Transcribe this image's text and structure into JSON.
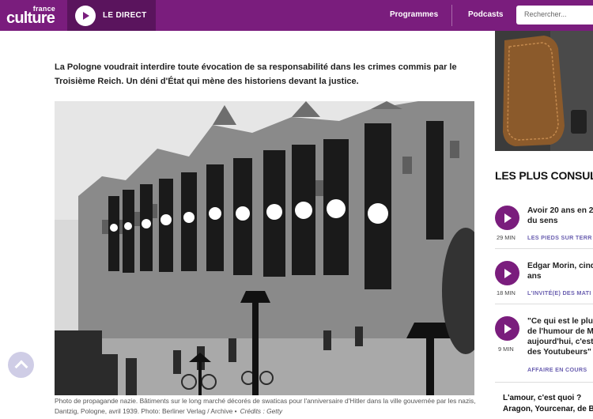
{
  "header": {
    "logo_top": "france",
    "logo_main": "culture",
    "live_label": "LE DIRECT",
    "nav": [
      "Programmes",
      "Podcasts"
    ],
    "search_placeholder": "Rechercher..."
  },
  "article": {
    "lead": "La Pologne voudrait interdire toute évocation de sa responsabilité dans les crimes commis par le Troisième Reich. Un déni d'État qui mène des historiens devant la justice.",
    "caption": "Photo de propagande nazie. Bâtiments sur le long marché décorés de swaticas pour l'anniversaire d'Hitler dans la ville gouvernée par les nazis, Dantzig, Pologne, avril 1939. Photo: Berliner Verlag / Archive •",
    "credit": "Crédits : Getty"
  },
  "sidebar": {
    "section_title": "LES PLUS CONSULT",
    "items": [
      {
        "title_line1": "Avoir 20 ans en 2",
        "title_line2": "du sens",
        "duration": "29 MIN",
        "category": "LES PIEDS SUR TERR"
      },
      {
        "title_line1": "Edgar Morin, cinq",
        "title_line2": "ans",
        "duration": "18 MIN",
        "category": "L'INVITÉ(E) DES MATI"
      },
      {
        "title_line1": "\"Ce qui est le plu",
        "title_line2": "de l'humour de M",
        "title_line3": "aujourd'hui, c'est",
        "title_line4": "des Youtubeurs\"",
        "duration": "9 MIN",
        "category": "AFFAIRE EN COURS"
      }
    ],
    "teaser_line1": "L'amour, c'est quoi ?",
    "teaser_line2": "Aragon, Yourcenar, de B"
  }
}
